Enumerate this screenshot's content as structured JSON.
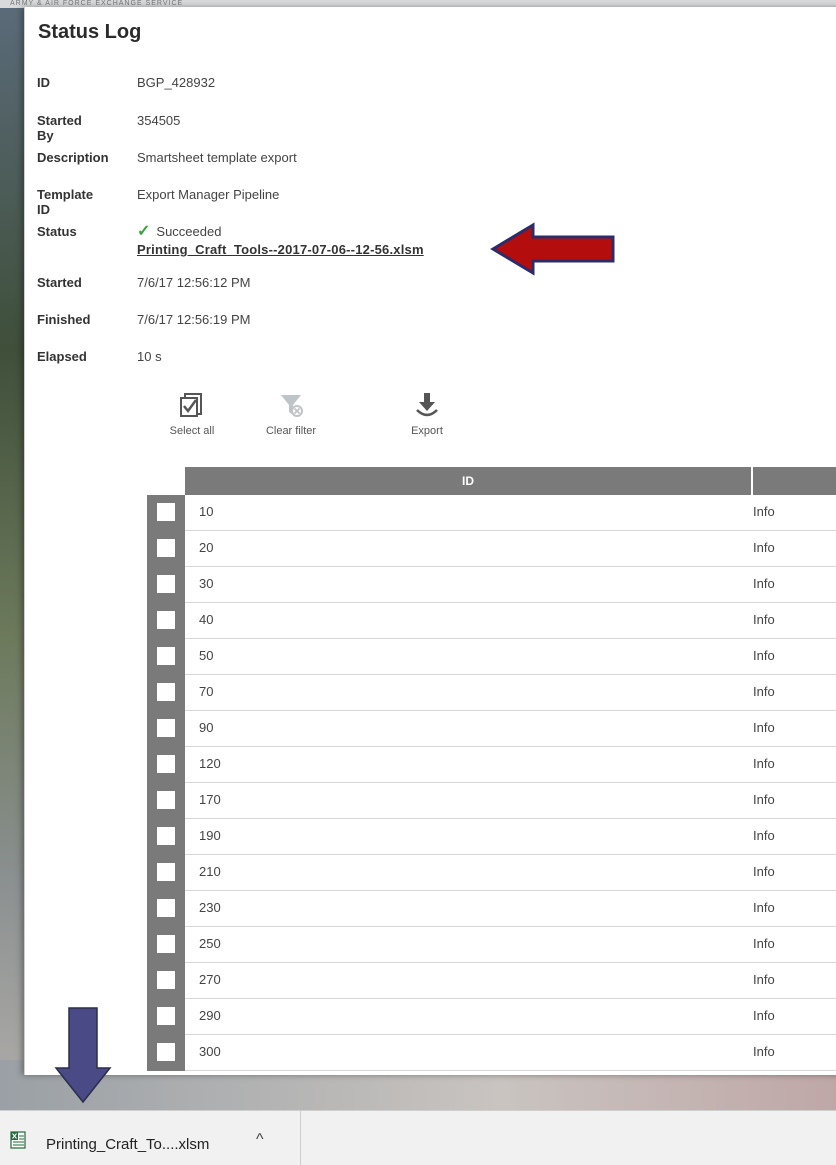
{
  "header": {
    "banner_text": "ARMY & AIR FORCE EXCHANGE SERVICE",
    "title": "Status Log"
  },
  "details": {
    "id_label": "ID",
    "id_value": "BGP_428932",
    "started_by_label": "Started By",
    "started_by_value": "354505",
    "description_label": "Description",
    "description_value": "Smartsheet template export",
    "template_label": "Template ID",
    "template_value": "Export Manager Pipeline",
    "status_label": "Status",
    "status_value": "Succeeded",
    "file_link": "Printing_Craft_Tools--2017-07-06--12-56.xlsm",
    "started_label": "Started",
    "started_value": "7/6/17 12:56:12 PM",
    "finished_label": "Finished",
    "finished_value": "7/6/17 12:56:19 PM",
    "elapsed_label": "Elapsed",
    "elapsed_value": "10 s"
  },
  "toolbar": {
    "select_all": "Select all",
    "clear_filter": "Clear filter",
    "export": "Export"
  },
  "grid": {
    "header_id": "ID",
    "rows": [
      {
        "id": "10",
        "level": "Info"
      },
      {
        "id": "20",
        "level": "Info"
      },
      {
        "id": "30",
        "level": "Info"
      },
      {
        "id": "40",
        "level": "Info"
      },
      {
        "id": "50",
        "level": "Info"
      },
      {
        "id": "70",
        "level": "Info"
      },
      {
        "id": "90",
        "level": "Info"
      },
      {
        "id": "120",
        "level": "Info"
      },
      {
        "id": "170",
        "level": "Info"
      },
      {
        "id": "190",
        "level": "Info"
      },
      {
        "id": "210",
        "level": "Info"
      },
      {
        "id": "230",
        "level": "Info"
      },
      {
        "id": "250",
        "level": "Info"
      },
      {
        "id": "270",
        "level": "Info"
      },
      {
        "id": "290",
        "level": "Info"
      },
      {
        "id": "300",
        "level": "Info"
      }
    ]
  },
  "download_bar": {
    "file_name": "Printing_Craft_To....xlsm"
  },
  "colors": {
    "arrow_red": "#b30d0d",
    "arrow_navy": "#4a4a86",
    "success_green": "#3ca23c",
    "grid_header": "#7a7a7a"
  }
}
